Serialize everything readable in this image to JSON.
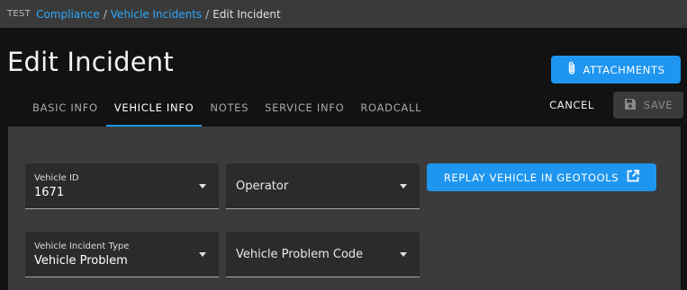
{
  "breadcrumb": {
    "env": "TEST",
    "items": [
      "Compliance",
      "Vehicle Incidents"
    ],
    "current": "Edit Incident"
  },
  "page": {
    "title": "Edit Incident"
  },
  "actions": {
    "attachments": "ATTACHMENTS",
    "cancel": "CANCEL",
    "save": "SAVE",
    "replay": "REPLAY VEHICLE IN GEOTOOLS"
  },
  "tabs": [
    {
      "label": "BASIC INFO",
      "active": false
    },
    {
      "label": "VEHICLE INFO",
      "active": true
    },
    {
      "label": "NOTES",
      "active": false
    },
    {
      "label": "SERVICE INFO",
      "active": false
    },
    {
      "label": "ROADCALL",
      "active": false
    }
  ],
  "fields": {
    "vehicle_id": {
      "label": "Vehicle ID",
      "value": "1671"
    },
    "operator": {
      "placeholder": "Operator"
    },
    "incident_type": {
      "label": "Vehicle Incident Type",
      "value": "Vehicle Problem"
    },
    "problem_code": {
      "placeholder": "Vehicle Problem Code"
    }
  },
  "colors": {
    "accent": "#1e96f0",
    "link": "#2ea8ff",
    "panel": "#3b3b3b",
    "field": "#2b2b2b"
  }
}
